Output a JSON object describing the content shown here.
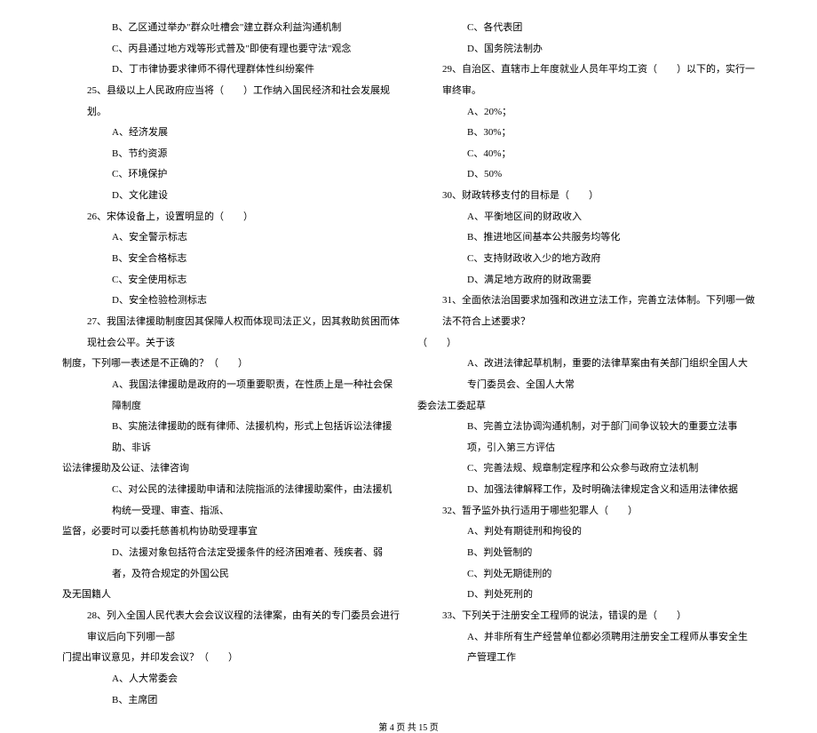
{
  "left": {
    "l1": "B、乙区通过举办\"群众吐槽会\"建立群众利益沟通机制",
    "l2": "C、丙县通过地方戏等形式普及\"即使有理也要守法\"观念",
    "l3": "D、丁市律协要求律师不得代理群体性纠纷案件",
    "l4": "25、县级以上人民政府应当将（　　）工作纳入国民经济和社会发展规划。",
    "l5": "A、经济发展",
    "l6": "B、节约资源",
    "l7": "C、环境保护",
    "l8": "D、文化建设",
    "l9": "26、宋体设备上，设置明显的（　　）",
    "l10": "A、安全警示标志",
    "l11": "B、安全合格标志",
    "l12": "C、安全使用标志",
    "l13": "D、安全检验检测标志",
    "l14": "27、我国法律援助制度因其保障人权而体现司法正义，因其救助贫困而体现社会公平。关于该",
    "l15": "制度，下列哪一表述是不正确的？（　　）",
    "l16": "A、我国法律援助是政府的一项重要职责，在性质上是一种社会保障制度",
    "l17": "B、实施法律援助的既有律师、法援机构，形式上包括诉讼法律援助、非诉",
    "l18": "讼法律援助及公证、法律咨询",
    "l19": "C、对公民的法律援助申请和法院指派的法律援助案件，由法援机构统一受理、审查、指派、",
    "l20": "监督，必要时可以委托慈善机构协助受理事宜",
    "l21": "D、法援对象包括符合法定受援条件的经济困难者、残疾者、弱者，及符合规定的外国公民",
    "l22": "及无国籍人",
    "l23": "28、列入全国人民代表大会会议议程的法律案，由有关的专门委员会进行审议后向下列哪一部",
    "l24": "门提出审议意见，并印发会议？（　　）",
    "l25": "A、人大常委会",
    "l26": "B、主席团"
  },
  "right": {
    "r1": "C、各代表团",
    "r2": "D、国务院法制办",
    "r3": "29、自治区、直辖市上年度就业人员年平均工资（　　）以下的，实行一审终审。",
    "r4": "A、20%；",
    "r5": "B、30%；",
    "r6": "C、40%；",
    "r7": "D、50%",
    "r8": "30、财政转移支付的目标是（　　）",
    "r9": "A、平衡地区间的财政收入",
    "r10": "B、推进地区间基本公共服务均等化",
    "r11": "C、支持财政收入少的地方政府",
    "r12": "D、满足地方政府的财政需要",
    "r13": "31、全面依法治国要求加强和改进立法工作，完善立法体制。下列哪一做法不符合上述要求？",
    "r14": "（　　）",
    "r15": "A、改进法律起草机制，重要的法律草案由有关部门组织全国人大专门委员会、全国人大常",
    "r16": "委会法工委起草",
    "r17": "B、完善立法协调沟通机制，对于部门间争议较大的重要立法事项，引入第三方评估",
    "r18": "C、完善法规、规章制定程序和公众参与政府立法机制",
    "r19": "D、加强法律解释工作，及时明确法律规定含义和适用法律依据",
    "r20": "32、暂予监外执行适用于哪些犯罪人（　　）",
    "r21": "A、判处有期徒刑和拘役的",
    "r22": "B、判处管制的",
    "r23": "C、判处无期徒刑的",
    "r24": "D、判处死刑的",
    "r25": "33、下列关于注册安全工程师的说法，错误的是（　　）",
    "r26": "A、并非所有生产经营单位都必须聘用注册安全工程师从事安全生产管理工作"
  },
  "footer": "第 4 页 共 15 页"
}
